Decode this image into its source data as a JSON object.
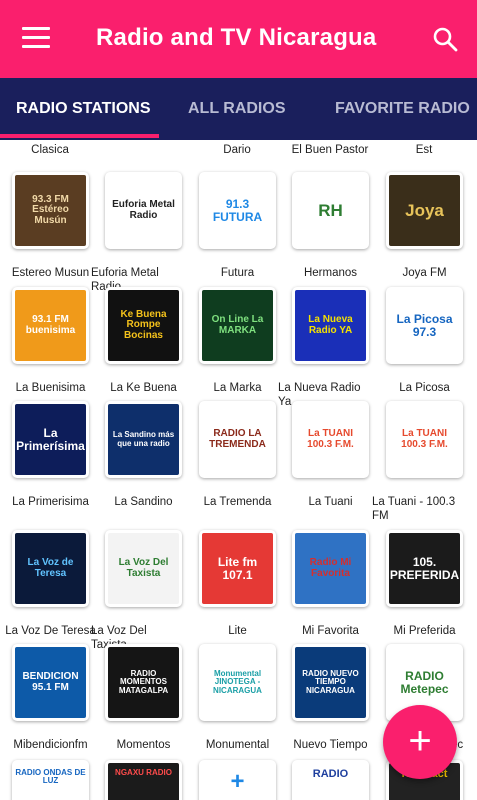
{
  "app": {
    "title": "Radio and TV Nicaragua",
    "accent": "#fa1f6d",
    "tabbar_color": "#1a1f5c"
  },
  "toolbar": {
    "menu_icon": "hamburger-menu-icon",
    "search_icon": "search-icon"
  },
  "tabs": [
    {
      "label": "RADIO STATIONS",
      "active": true
    },
    {
      "label": "ALL RADIOS",
      "active": false
    },
    {
      "label": "FAVORITE RADIO",
      "active": false
    }
  ],
  "top_row_labels": [
    "Clasica",
    "Dario",
    "El Buen Pastor",
    "Est"
  ],
  "stations": [
    {
      "name": "Estereo Musun",
      "logo_text": "93.3 FM Estéreo Musún",
      "bg": "#5a3d22",
      "fg": "#f1d9a8"
    },
    {
      "name": "Euforia Metal Radio",
      "logo_text": "Euforia Metal Radio",
      "bg": "#ffffff",
      "fg": "#222222"
    },
    {
      "name": "Futura",
      "logo_text": "91.3 FUTURA",
      "bg": "#ffffff",
      "fg": "#1e88e5"
    },
    {
      "name": "Hermanos",
      "logo_text": "RH",
      "bg": "#ffffff",
      "fg": "#2e7d32"
    },
    {
      "name": "Joya FM",
      "logo_text": "Joya",
      "bg": "#3a2e1a",
      "fg": "#e7c35a"
    },
    {
      "name": "La Buenisima",
      "logo_text": "93.1 FM buenisima",
      "bg": "#f09a1a",
      "fg": "#ffffff"
    },
    {
      "name": "La Ke Buena",
      "logo_text": "Ke Buena Rompe Bocinas",
      "bg": "#111111",
      "fg": "#f4c21b"
    },
    {
      "name": "La Marka",
      "logo_text": "On Line La MARKA",
      "bg": "#0f3d1f",
      "fg": "#7fe07f"
    },
    {
      "name": "La Nueva Radio Ya",
      "logo_text": "La Nueva Radio YA",
      "bg": "#1a2fb8",
      "fg": "#f5e100"
    },
    {
      "name": "La Picosa",
      "logo_text": "La Picosa 97.3",
      "bg": "#ffffff",
      "fg": "#1565c0"
    },
    {
      "name": "La Primerisima",
      "logo_text": "La Primerísima",
      "bg": "#0d1d5a",
      "fg": "#ffffff"
    },
    {
      "name": "La Sandino",
      "logo_text": "La Sandino más que una radio",
      "bg": "#0e2f6b",
      "fg": "#ffffff"
    },
    {
      "name": "La Tremenda",
      "logo_text": "RADIO LA TREMENDA",
      "bg": "#ffffff",
      "fg": "#8b2a1b"
    },
    {
      "name": "La Tuani",
      "logo_text": "La TUANI 100.3 F.M.",
      "bg": "#ffffff",
      "fg": "#e64a2e"
    },
    {
      "name": "La Tuani - 100.3 FM",
      "logo_text": "La TUANI 100.3 F.M.",
      "bg": "#ffffff",
      "fg": "#e64a2e"
    },
    {
      "name": "La Voz De Teresa",
      "logo_text": "La Voz de Teresa",
      "bg": "#0b1a3a",
      "fg": "#61c3ff"
    },
    {
      "name": "La Voz Del Taxista",
      "logo_text": "La Voz Del Taxista",
      "bg": "#f3f3f3",
      "fg": "#2e7d32"
    },
    {
      "name": "Lite",
      "logo_text": "Lite fm 107.1",
      "bg": "#e53935",
      "fg": "#ffffff"
    },
    {
      "name": "Mi Favorita",
      "logo_text": "Radio Mi Favorita",
      "bg": "#2f72c4",
      "fg": "#d32f2f"
    },
    {
      "name": "Mi Preferida",
      "logo_text": "105. PREFERIDA",
      "bg": "#1b1b1b",
      "fg": "#ffffff"
    },
    {
      "name": "Mibendicionfm",
      "logo_text": "BENDICION 95.1 FM",
      "bg": "#0d5aa8",
      "fg": "#ffffff"
    },
    {
      "name": "Momentos",
      "logo_text": "RADIO MOMENTOS MATAGALPA",
      "bg": "#151515",
      "fg": "#ffffff"
    },
    {
      "name": "Monumental",
      "logo_text": "Monumental JINOTEGA - NICARAGUA",
      "bg": "#ffffff",
      "fg": "#1a9fa6"
    },
    {
      "name": "Nuevo Tiempo",
      "logo_text": "RADIO NUEVO TIEMPO NICARAGUA",
      "bg": "#0a3b7a",
      "fg": "#ffffff"
    },
    {
      "name": "Radio Metepec",
      "logo_text": "RADIO Metepec",
      "bg": "#ffffff",
      "fg": "#2e7d32"
    }
  ],
  "partial_row": [
    {
      "logo_text": "RADIO ONDAS DE LUZ",
      "bg": "#ffffff",
      "fg": "#1565c0"
    },
    {
      "logo_text": "NGAXU RADIO",
      "bg": "#1b1b1b",
      "fg": "#ff4b4b"
    },
    {
      "logo_text": "+",
      "bg": "#ffffff",
      "fg": "#1e88e5"
    },
    {
      "logo_text": "RADIO",
      "bg": "#ffffff",
      "fg": "#1e3f9e"
    },
    {
      "logo_text": "radio act",
      "bg": "#222222",
      "fg": "#f2c200"
    }
  ],
  "fab": {
    "label": "+",
    "icon": "plus-icon"
  }
}
